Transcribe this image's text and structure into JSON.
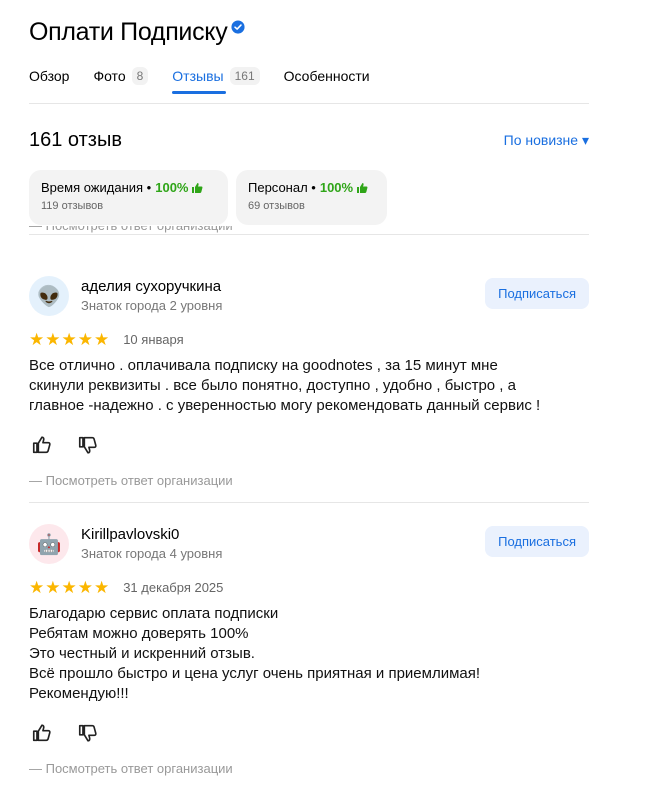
{
  "header": {
    "title": "Оплати Подписку",
    "verified_icon": "verified-check-icon"
  },
  "tabs": [
    {
      "label": "Обзор",
      "count": null
    },
    {
      "label": "Фото",
      "count": "8"
    },
    {
      "label": "Отзывы",
      "count": "161",
      "active": true
    },
    {
      "label": "Особенности",
      "count": null
    }
  ],
  "reviews_summary": {
    "title": "161 отзыв",
    "sort_label": "По новизне ▾"
  },
  "chips": [
    {
      "label": "Время ожидания •",
      "percent": "100%",
      "sub": "119 отзывов"
    },
    {
      "label": "Персонал •",
      "percent": "100%",
      "sub": "69 отзывов"
    }
  ],
  "cut_reply_label": "— Посмотреть ответ организации",
  "reviews": [
    {
      "author": "аделия сухоручкина",
      "level": "Знаток города 2 уровня",
      "avatar_icon": "alien-emoji-avatar",
      "avatar_glyph": "👽",
      "rating": 5,
      "stars": "★★★★★",
      "date": "10 января",
      "subscribe_label": "Подписаться",
      "text": "Все отлично . оплачивала подписку на goodnotes , за 15 минут мне\nскинули реквизиты . все было понятно, доступно , удобно , быстро , а\nглавное -надежно . с уверенностью могу рекомендовать данный сервис !",
      "reply_label": "— Посмотреть ответ организации"
    },
    {
      "author": "Kirillpavlovski0",
      "level": "Знаток города 4 уровня",
      "avatar_icon": "robot-avatar",
      "avatar_glyph": "🤖",
      "rating": 5,
      "stars": "★★★★★",
      "date": "31 декабря 2025",
      "subscribe_label": "Подписаться",
      "text": "Благодарю сервис оплата подписки\nРебятам можно доверять 100%\nЭто честный и искренний отзыв.\nВсё прошло быстро и цена услуг очень приятная и приемлимая!\nРекомендую!!!",
      "reply_label": "— Посмотреть ответ организации"
    }
  ],
  "colors": {
    "accent": "#1a6fe0",
    "star": "#fbb600",
    "positive": "#2fa518"
  }
}
